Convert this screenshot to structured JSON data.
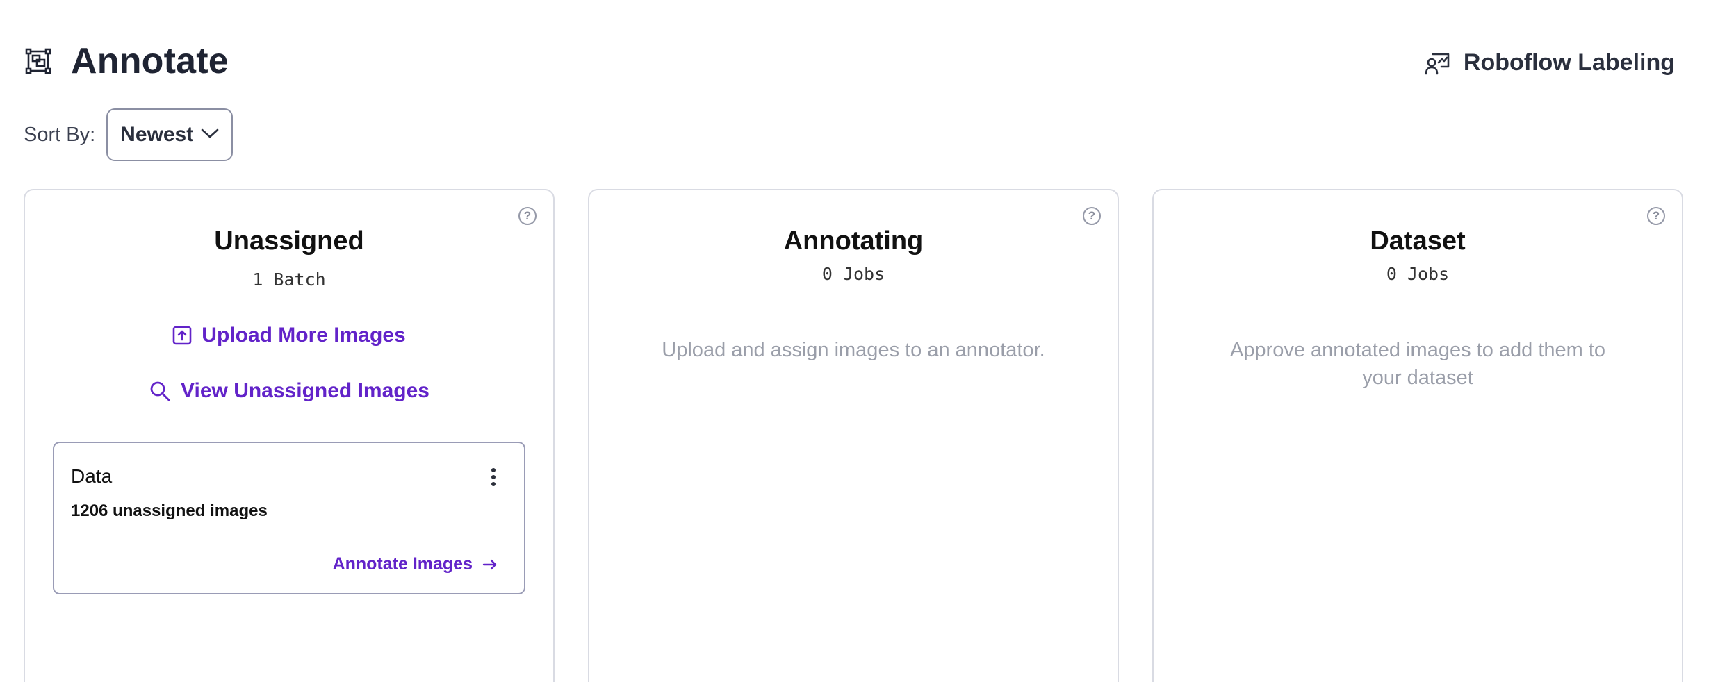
{
  "header": {
    "title": "Annotate",
    "title_icon": "annotate-frame-icon",
    "labeling_button": {
      "label": "Roboflow Labeling",
      "icon": "labeler-icon"
    }
  },
  "sort": {
    "label": "Sort By:",
    "selected": "Newest",
    "icon": "chevron-down-icon"
  },
  "columns": {
    "unassigned": {
      "title": "Unassigned",
      "subtitle": "1 Batch",
      "help_icon": "question-circle-icon",
      "upload_label": "Upload More Images",
      "view_label": "View Unassigned Images",
      "batches": [
        {
          "name": "Data",
          "count_text": "1206 unassigned images",
          "action_label": "Annotate Images"
        }
      ]
    },
    "annotating": {
      "title": "Annotating",
      "subtitle": "0 Jobs",
      "help_icon": "question-circle-icon",
      "empty_text": "Upload and assign images to an annotator."
    },
    "dataset": {
      "title": "Dataset",
      "subtitle": "0 Jobs",
      "help_icon": "question-circle-icon",
      "empty_text": "Approve annotated images to add them to your dataset"
    }
  },
  "colors": {
    "accent": "#6223c9",
    "muted_text": "#9a9ea9",
    "border": "#d9dbe3"
  }
}
